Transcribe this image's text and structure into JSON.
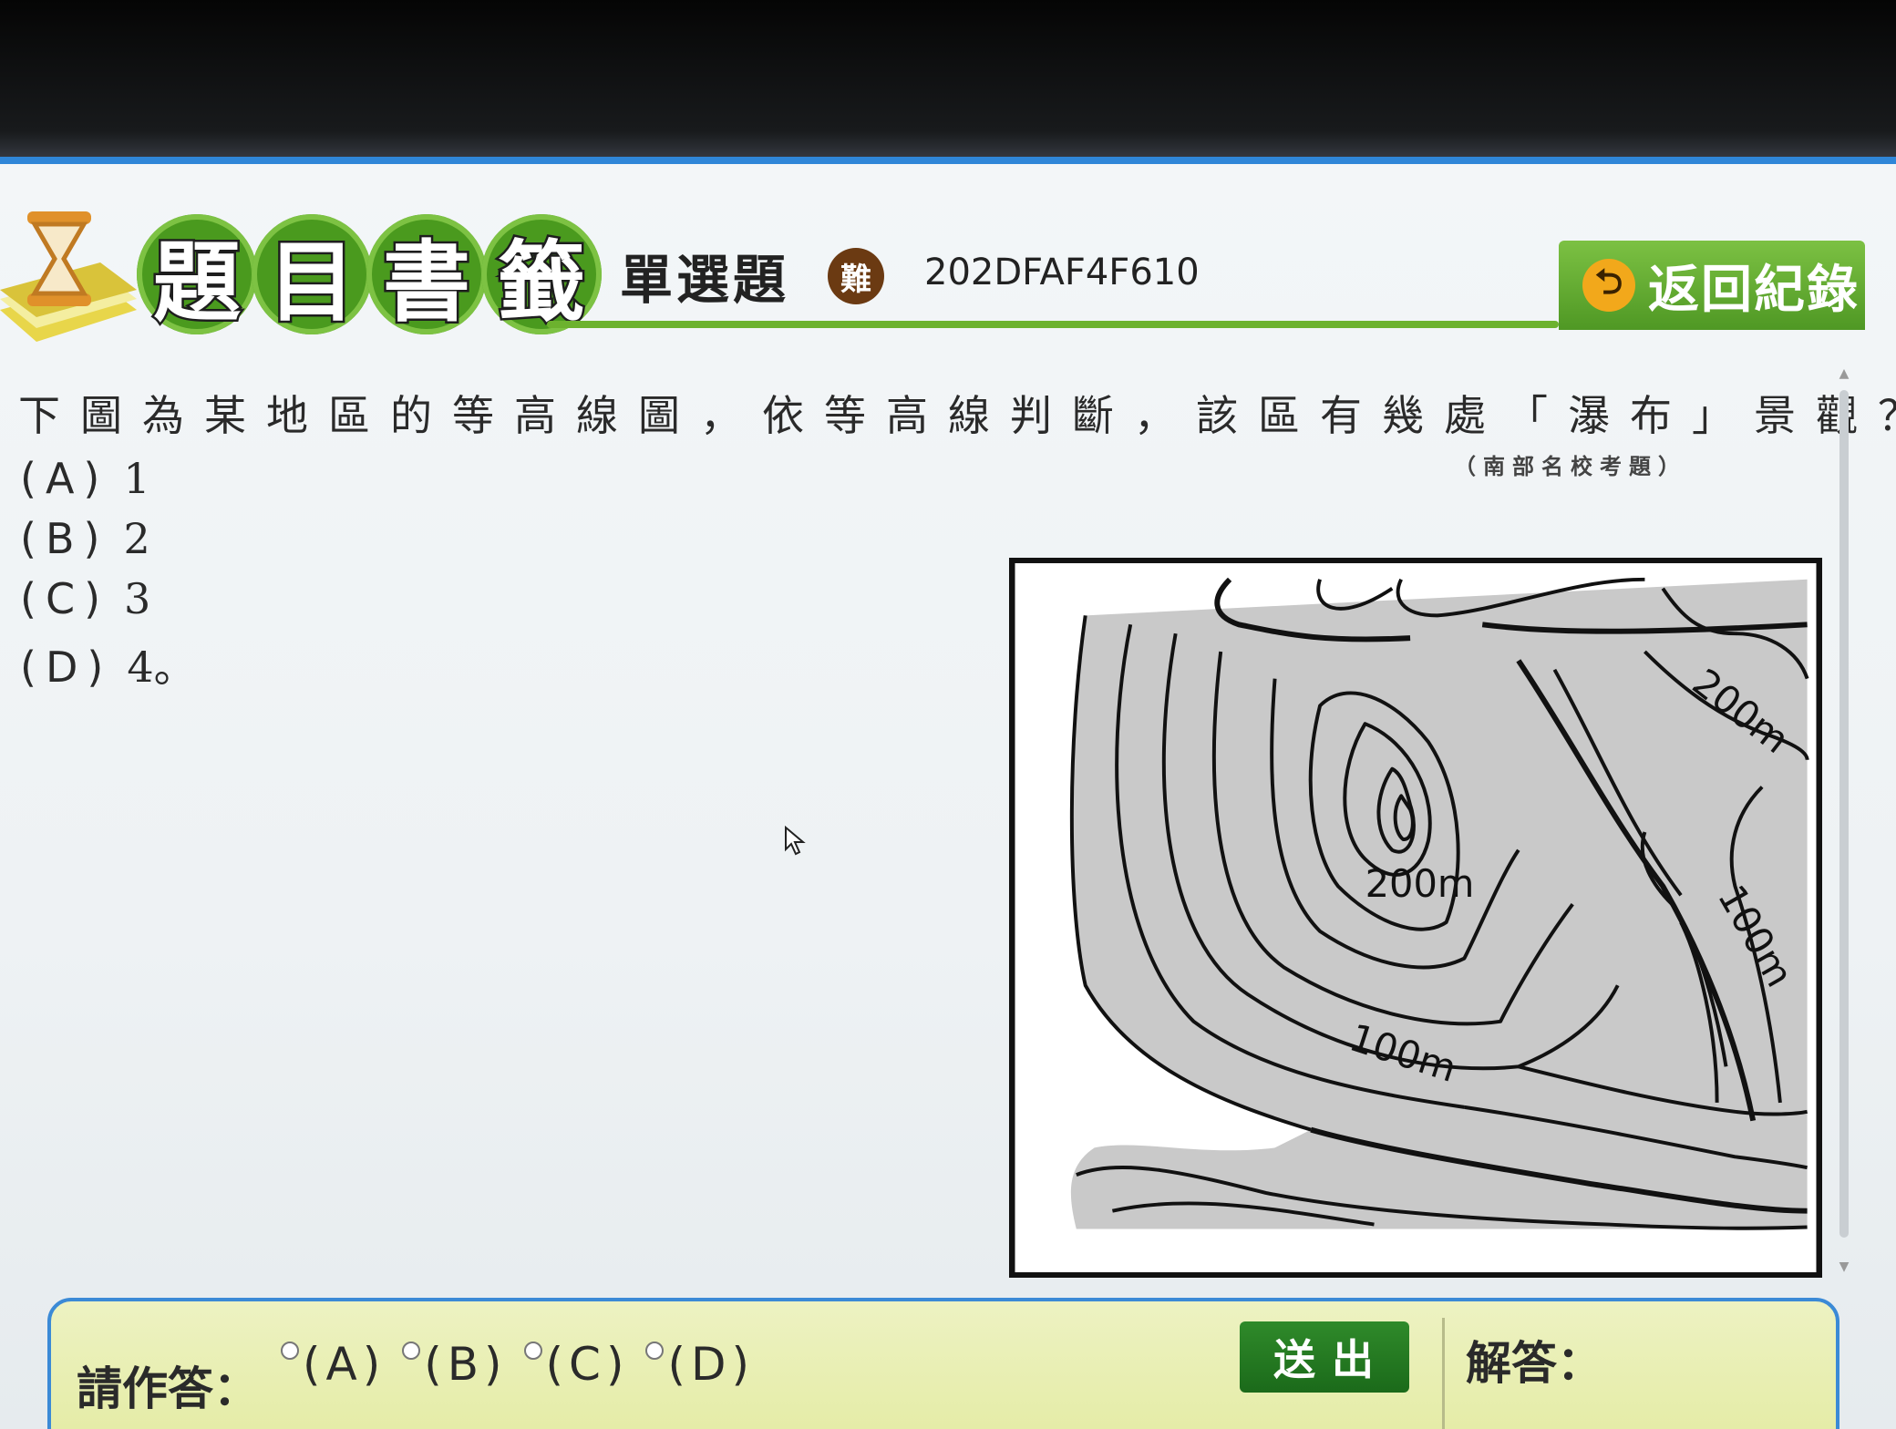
{
  "header": {
    "logo_chars": [
      "題",
      "目",
      "書",
      "籤"
    ],
    "question_type": "單選題",
    "difficulty": "難",
    "question_id": "202DFAF4F610",
    "back_button": "返回紀錄"
  },
  "question": {
    "text": "下圖為某地區的等高線圖，依等高線判斷，該區有幾處「瀑布」景觀？",
    "source": "（南部名校考題）",
    "options": [
      {
        "tag": "(A)",
        "value": "1"
      },
      {
        "tag": "(B)",
        "value": "2"
      },
      {
        "tag": "(C)",
        "value": "3"
      },
      {
        "tag": "(D)",
        "value": "4。"
      }
    ]
  },
  "map": {
    "labels": {
      "summit": "200m",
      "center": "100m",
      "right_top": "200m",
      "right_mid": "100m"
    },
    "colors": {
      "land": "#c9c9c9",
      "water": "#ffffff",
      "lines": "#111111"
    }
  },
  "answer_bar": {
    "prompt": "請作答：",
    "choices": [
      "(A)",
      "(B)",
      "(C)",
      "(D)"
    ],
    "submit": "送出",
    "solution_label": "解答："
  },
  "colors": {
    "accent_green": "#6cb22e",
    "frame_blue": "#2f86d8",
    "answer_bg": "#e7eeb0"
  }
}
